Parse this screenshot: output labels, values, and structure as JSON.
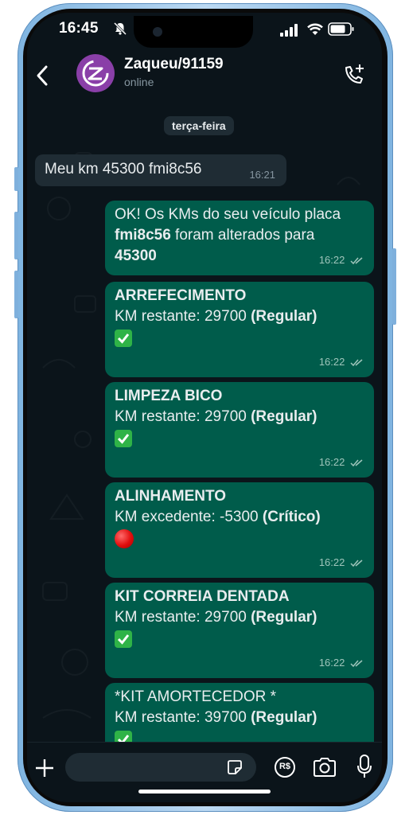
{
  "status_bar": {
    "time": "16:45"
  },
  "header": {
    "contact_name": "Zaqueu/91159",
    "contact_status": "online"
  },
  "chat": {
    "date_chip": "terça-feira",
    "incoming": {
      "text": "Meu km 45300 fmi8c56",
      "time": "16:21"
    },
    "outgoing": [
      {
        "line1": "OK! Os KMs do seu veículo placa",
        "plate": "fmi8c56",
        "line2_rest": " foram alterados para",
        "km": "45300",
        "time": "16:22"
      },
      {
        "title": "ARREFECIMENTO",
        "label": "KM restante: 29700",
        "status": "(Regular)",
        "emoji": "check",
        "time": "16:22"
      },
      {
        "title": "LIMPEZA BICO",
        "label": "KM restante: 29700",
        "status": "(Regular)",
        "emoji": "check",
        "time": "16:22"
      },
      {
        "title": "ALINHAMENTO",
        "label": "KM excedente: -5300",
        "status": "(Crítico)",
        "emoji": "red-circle",
        "time": "16:22"
      },
      {
        "title": "KIT CORREIA DENTADA",
        "label": "KM restante: 29700",
        "status": "(Regular)",
        "emoji": "check",
        "time": "16:22"
      },
      {
        "title": "*KIT AMORTECEDOR *",
        "label": "KM restante: 39700",
        "status": "(Regular)",
        "emoji": "check"
      }
    ]
  },
  "composer": {
    "input_value": "",
    "pay_label": "R$"
  },
  "colors": {
    "background": "#0b141a",
    "outgoing_bubble": "#005c4b",
    "incoming_bubble": "#1f2c34",
    "read_ticks": "#9fc5bb",
    "phone_frame": "#7fb4e0"
  }
}
